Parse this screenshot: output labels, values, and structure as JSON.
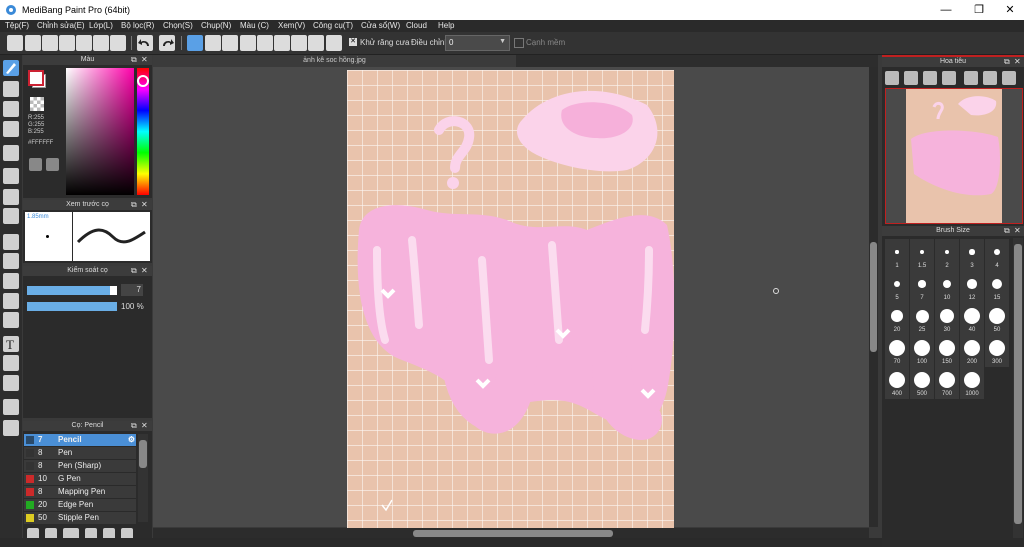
{
  "window": {
    "title": "MediBang Paint Pro (64bit)",
    "controls": [
      "—",
      "❐",
      "✕"
    ]
  },
  "menu": [
    "Tệp(F)",
    "Chỉnh sửa(E)",
    "Lớp(L)",
    "Bộ lọc(R)",
    "Chọn(S)",
    "Chụp(N)",
    "Màu (C)",
    "Xem(V)",
    "Công cụ(T)",
    "Cửa sổ(W)",
    "Cloud",
    "Help"
  ],
  "toolbar": {
    "antialias_label": "Khử răng cưa",
    "adjust_label": "Điều chỉnh",
    "adjust_value": "0",
    "edge_label": "Cạnh mềm"
  },
  "color_panel": {
    "title": "Màu",
    "rgb": [
      "R:255",
      "G:255",
      "B:255"
    ],
    "hex": "#FFFFFF",
    "primary_color": "#cc2233",
    "secondary_color": "#ffffff"
  },
  "brush_preview": {
    "title": "Xem trước cọ",
    "size_text": "1.85mm"
  },
  "brush_control": {
    "title": "Kiểm soát cọ",
    "size_value": "7",
    "opacity_value": "100 %",
    "size_fill": 0.92,
    "opacity_fill": 1.0
  },
  "brush_list": {
    "title": "Cọ: Pencil",
    "items": [
      {
        "size": "7",
        "name": "Pencil",
        "color": "#2a4a6a",
        "selected": true
      },
      {
        "size": "8",
        "name": "Pen",
        "color": "#333333"
      },
      {
        "size": "8",
        "name": "Pen (Sharp)",
        "color": "#333333"
      },
      {
        "size": "10",
        "name": "G Pen",
        "color": "#cc2a2a"
      },
      {
        "size": "8",
        "name": "Mapping Pen",
        "color": "#cc2a2a"
      },
      {
        "size": "20",
        "name": "Edge Pen",
        "color": "#22aa22"
      },
      {
        "size": "50",
        "name": "Stipple Pen",
        "color": "#ddcc22"
      }
    ]
  },
  "document": {
    "tab_title": "ảnh kê soc hồng.jpg"
  },
  "navigator": {
    "title": "Hoa tiêu"
  },
  "brush_size": {
    "title": "Brush Size",
    "sizes": [
      "1",
      "1.5",
      "2",
      "3",
      "4",
      "5",
      "7",
      "10",
      "12",
      "15",
      "20",
      "25",
      "30",
      "40",
      "50",
      "70",
      "100",
      "150",
      "200",
      "300",
      "400",
      "500",
      "700",
      "1000"
    ]
  }
}
